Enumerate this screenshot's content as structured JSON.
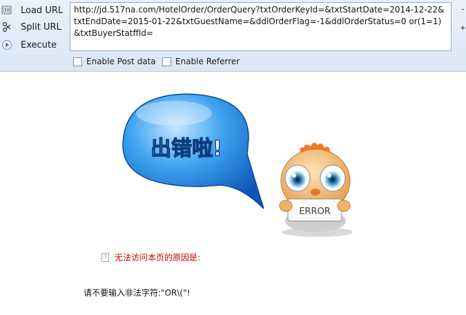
{
  "toolbar": {
    "items": [
      {
        "label": "Load URL",
        "icon": "load-url-icon"
      },
      {
        "label": "Split URL",
        "icon": "split-url-icon"
      },
      {
        "label": "Execute",
        "icon": "execute-icon"
      }
    ],
    "url_value": "http://jd.517na.com/HotelOrder/OrderQuery?txtOrderKeyId=&txtStartDate=2014-12-22&txtEndDate=2015-01-22&txtGuestName=&ddlOrderFlag=-1&ddlOrderStatus=0 or(1=1)&txtBuyerStatffId=",
    "side_marks": [
      "-",
      "+"
    ],
    "options": [
      {
        "label": "Enable Post data",
        "checked": false
      },
      {
        "label": "Enable Referrer",
        "checked": false
      }
    ]
  },
  "error_page": {
    "bubble_text": "出错啦!",
    "sign_text": "ERROR",
    "reason_label": "无法访问本页的原因是:",
    "detail": "请不要输入非法字符:\"OR\\(\"!",
    "colors": {
      "bubble": "#2f8fe6",
      "reason": "#cc0000",
      "mascot": "#f0a64a"
    }
  }
}
